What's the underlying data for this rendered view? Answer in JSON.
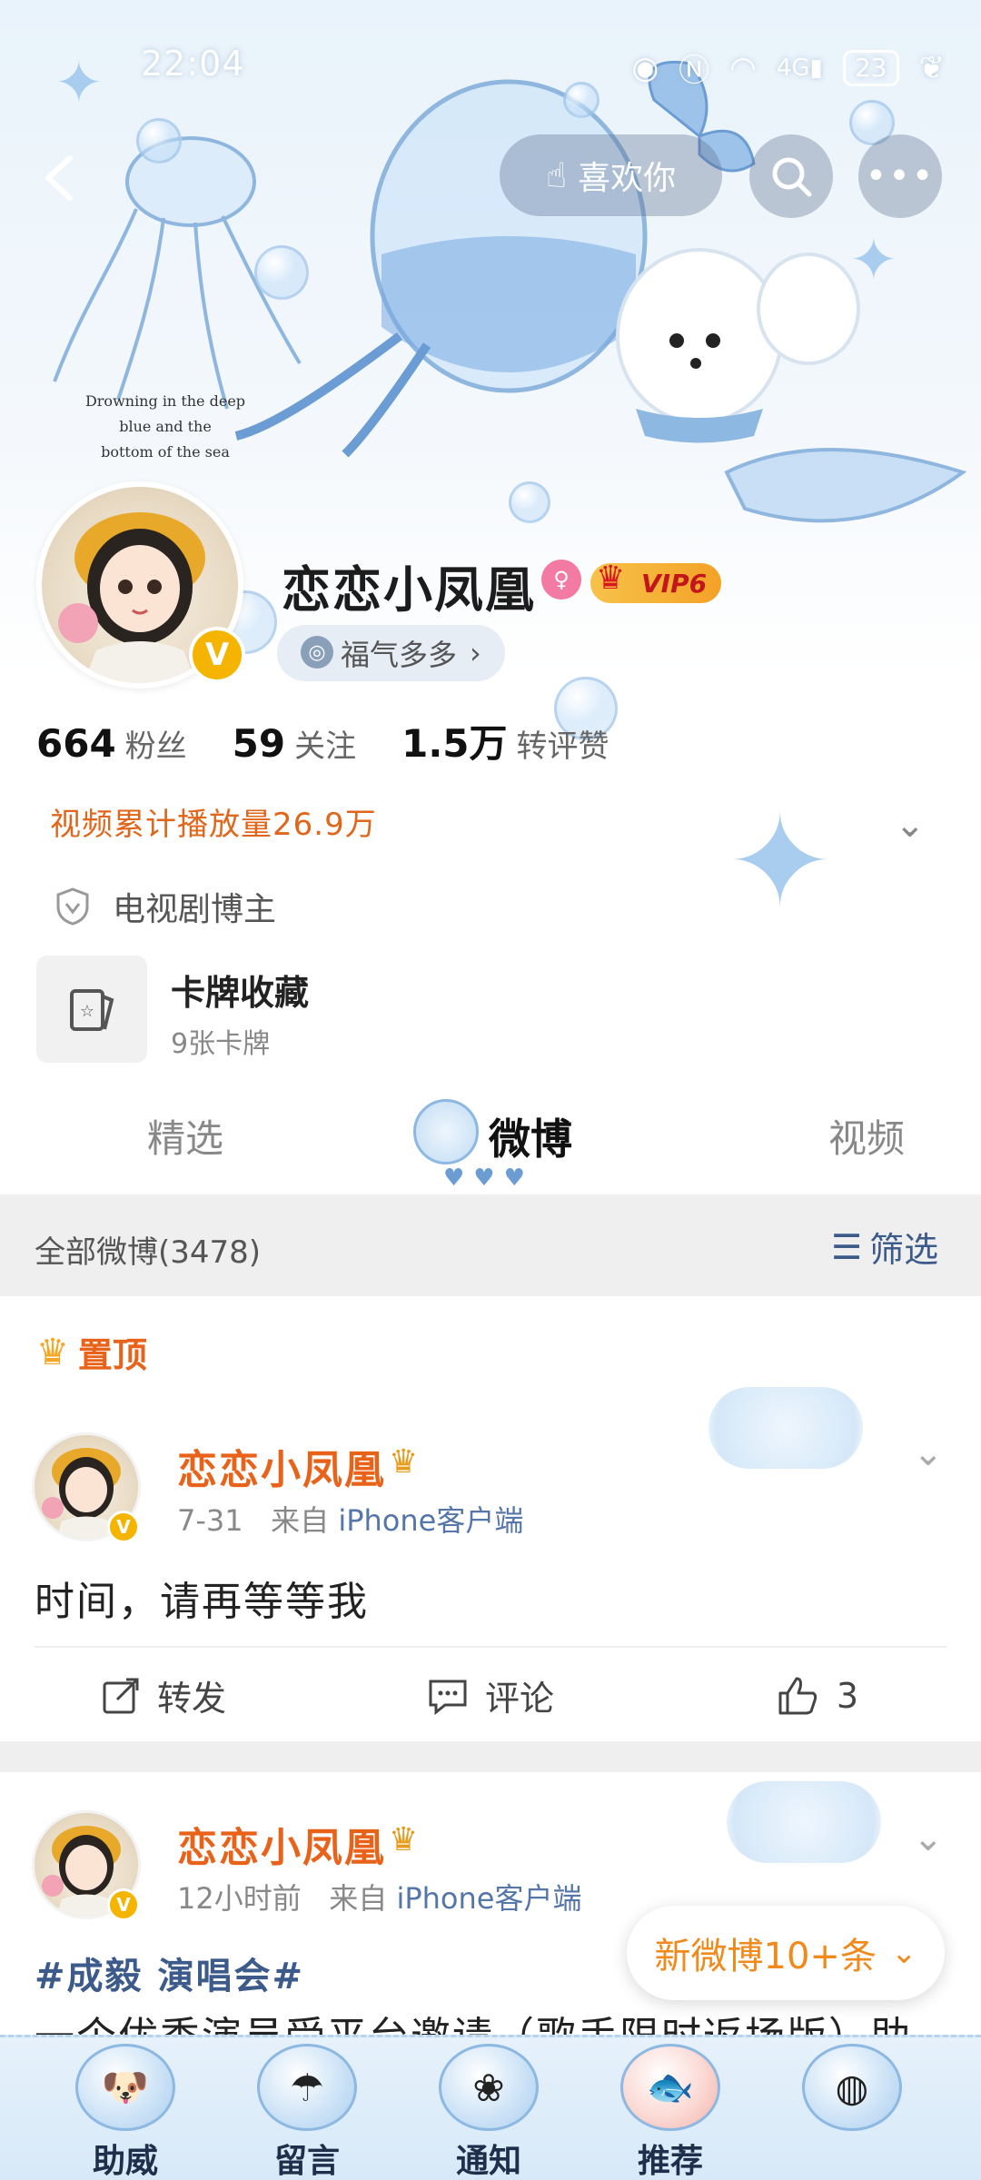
{
  "status_bar": {
    "time": "22:04",
    "icons": [
      "eye-icon",
      "nfc-icon",
      "wifi-icon",
      "4g-signal-icon"
    ],
    "signal_text": "4G",
    "battery": "23"
  },
  "header": {
    "like_label": "喜欢你",
    "illustration_text": [
      "Drowning in the deep",
      "blue and the",
      "bottom of the sea"
    ]
  },
  "profile": {
    "name": "恋恋小凤凰",
    "vip_label": "VIP6",
    "fortune_label": "福气多多",
    "stats": [
      {
        "value": "664",
        "label": "粉丝"
      },
      {
        "value": "59",
        "label": "关注"
      },
      {
        "value": "1.5万",
        "label": "转评赞"
      }
    ],
    "play_count": "视频累计播放量26.9万",
    "tag": "电视剧博主",
    "card_title": "卡牌收藏",
    "card_sub": "9张卡牌"
  },
  "tabs": [
    {
      "label": "精选",
      "active": false
    },
    {
      "label": "微博",
      "active": true
    },
    {
      "label": "视频",
      "active": false
    }
  ],
  "filter": {
    "all_label": "全部微博(3478)",
    "filter_label": "筛选"
  },
  "pinned_label": "置顶",
  "posts": [
    {
      "name": "恋恋小凤凰",
      "time": "7-31",
      "from": "来自",
      "source": "iPhone客户端",
      "text": "时间，请再等等我",
      "repost": "转发",
      "comment": "评论",
      "likes": "3"
    },
    {
      "name": "恋恋小凤凰",
      "time": "12小时前",
      "from": "来自",
      "source": "iPhone客户端",
      "hashtag": "#成毅 演唱会#",
      "text": "一个优秀演员受平台邀请（歌手限时返场版）助"
    }
  ],
  "new_posts_label": "新微博10+条",
  "bottom_nav": [
    {
      "label": "助威",
      "icon": "puppy-icon"
    },
    {
      "label": "留言",
      "icon": "jellyfish-icon"
    },
    {
      "label": "通知",
      "icon": "butterfly-icon"
    },
    {
      "label": "推荐",
      "icon": "fish-icon"
    },
    {
      "label": "",
      "icon": "bubble-icon"
    }
  ],
  "colors": {
    "accent_orange": "#e8621a",
    "vip_gold": "#f5b400",
    "link_blue": "#5576a8"
  }
}
